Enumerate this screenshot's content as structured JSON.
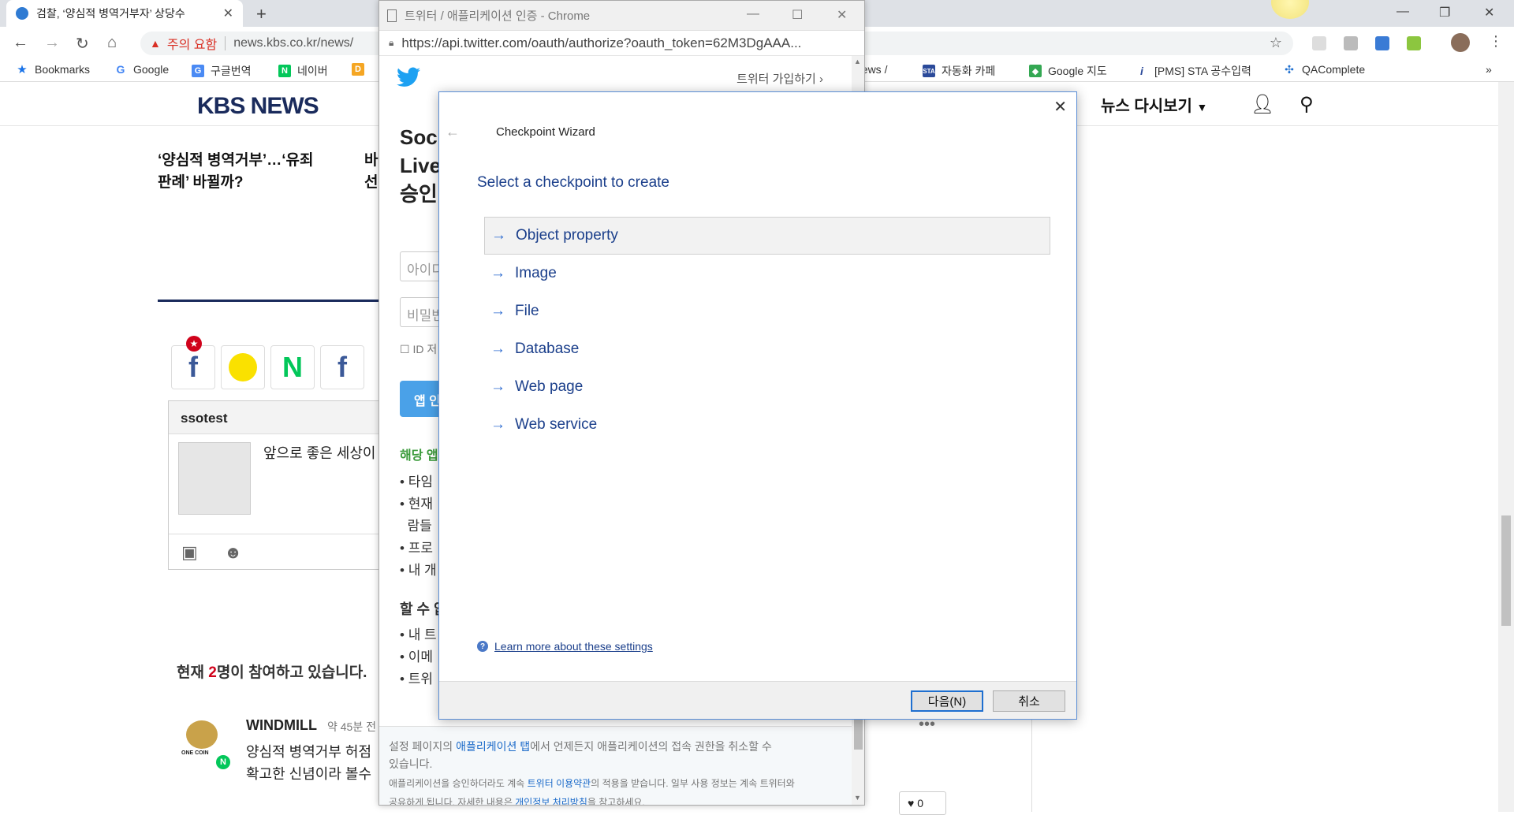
{
  "browser": {
    "tab_title": "검찰, ‘양심적 병역거부자’ 상당수",
    "tab_close": "✕",
    "new_tab": "+",
    "warning_label": "주의 요함",
    "url": "news.kbs.co.kr/news/",
    "bookmarks": [
      "Bookmarks",
      "Google",
      "구글번역",
      "네이버",
      "news /",
      "자동화 카페",
      "Google 지도",
      "[PMS] STA 공수입력",
      "QAComplete"
    ],
    "bookmarks_more": "»"
  },
  "kbs": {
    "logo": "KBS NEWS",
    "nav_replay": "뉴스 다시보기",
    "article1_line1": "‘양심적 병역거부’…‘유죄",
    "article1_line2": "판례’ 바뀔까?",
    "article2_line1": "바",
    "article2_line2": "선",
    "comment_user": "ssotest",
    "comment_text": "앞으로 좋은 세상이",
    "participants_prefix": "현재 ",
    "participants_count": "2",
    "participants_suffix": "명이 참여하고 있습니다.",
    "cmt_author": "WINDMILL",
    "cmt_time": "약 45분 전",
    "cmt_line1": "양심적 병역거부 허점",
    "cmt_line2": "확고한 신념이라 볼수",
    "onecoin_label": "ONE COIN",
    "like_count": "0",
    "more": "•••"
  },
  "popup": {
    "title": "트위터 / 애플리케이션 인증 - Chrome",
    "url": "https://api.twitter.com/oauth/authorize?oauth_token=62M3DgAAA...",
    "join": "트위터 가입하기 ›",
    "heading_l1": "Soc",
    "heading_l2": "Live",
    "heading_l3": "승인",
    "id_placeholder": "아이디",
    "pw_placeholder": "비밀번",
    "remember": "ID 저",
    "app_button": "앱 인",
    "green_heading": "해당 앱",
    "list1": [
      "타임",
      "현재",
      "람들",
      "프로",
      "내 개"
    ],
    "can_heading": "할 수 없",
    "list2": [
      "내 트",
      "이메",
      "트위"
    ],
    "footer_l1_a": "설정 페이지의 ",
    "footer_l1_link": "애플리케이션 탭",
    "footer_l1_b": "에서 언제든지 애플리케이션의 접속 권한을 취소할 수",
    "footer_l2": "있습니다.",
    "footer_small_a": "애플리케이션을 승인하더라도 계속 ",
    "footer_small_link": "트위터 이용약관",
    "footer_small_b": "의 적용을 받습니다. 일부 사용 정보는 계속 트위터와",
    "footer_small_c": "공유하게 됩니다. 자세한 내용은 ",
    "footer_small_link2": "개인정보 처리방침",
    "footer_small_d": "을 참고하세요."
  },
  "wizard": {
    "title": "Checkpoint Wizard",
    "heading": "Select a checkpoint to create",
    "options": [
      "Object property",
      "Image",
      "File",
      "Database",
      "Web page",
      "Web service"
    ],
    "selected_index": 0,
    "learn_more": "Learn more about these settings",
    "next_button": "다음(N)",
    "cancel_button": "취소"
  },
  "colors": {
    "accent": "#1e6fd0",
    "wizard_text": "#1b3f8b",
    "warning": "#d93025",
    "twitter": "#1da1f2",
    "kbs_navy": "#1a2b5c"
  }
}
